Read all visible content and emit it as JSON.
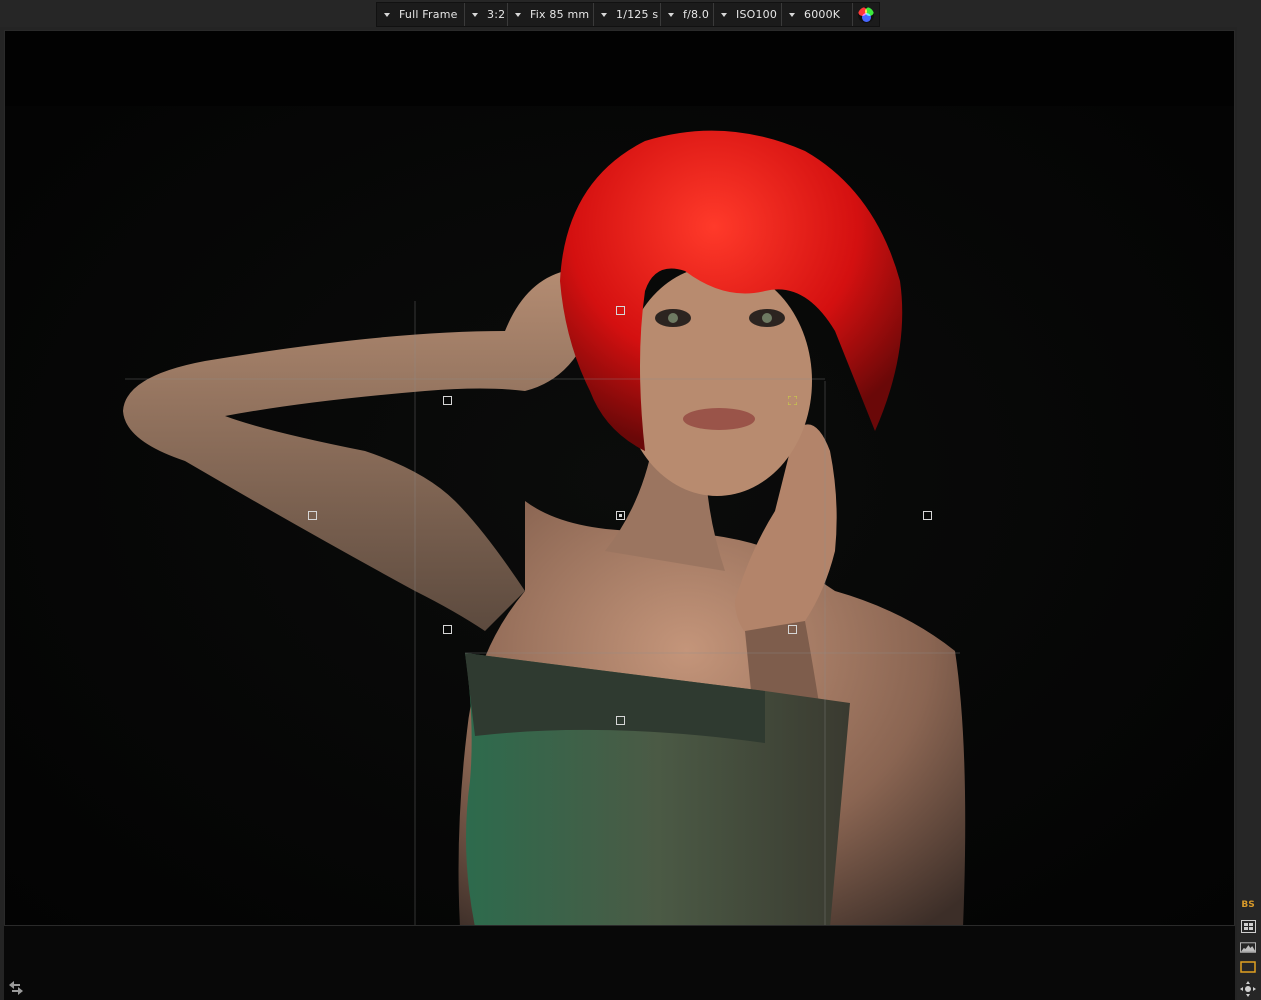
{
  "toolbar": {
    "sensor": "Full Frame",
    "aspect": "3:2",
    "lens": "Fix 85 mm",
    "shutter": "1/125 s",
    "aperture": "f/8.0",
    "iso": "ISO100",
    "white_balance": "6000K",
    "color_icon": "rgb-color-wheel-icon"
  },
  "side_panel": {
    "label": "BS",
    "icons": [
      "focus-grid-icon",
      "histogram-icon",
      "frame-icon",
      "navigate-icon"
    ]
  },
  "colors": {
    "hair": "#e01616",
    "top": "#3e5a45",
    "skin": "#b8876a",
    "background": "#050505",
    "bs_accent": "#d99a2a",
    "af_active": "#c9c94a"
  }
}
